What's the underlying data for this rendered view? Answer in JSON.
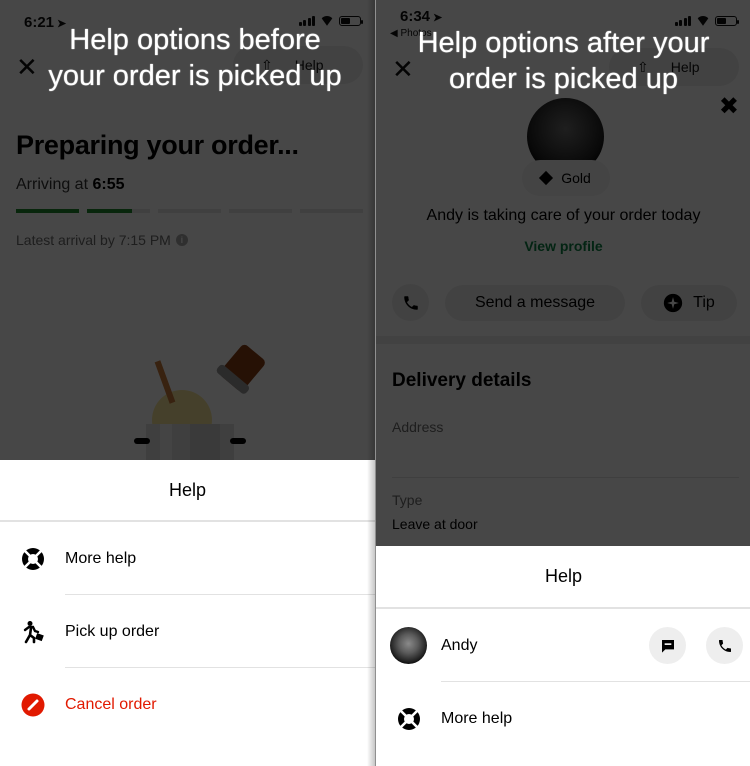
{
  "left": {
    "caption": [
      "Help options before",
      "your order is picked up"
    ],
    "status_bar": {
      "time": "6:21"
    },
    "header": {
      "help_label": "Help"
    },
    "order": {
      "title": "Preparing your order...",
      "arriving_prefix": "Arriving at",
      "arriving_time": "6:55",
      "progress_segments": [
        1.0,
        0.72,
        0,
        0,
        0
      ],
      "latest_arrival": "Latest arrival by 7:15 PM"
    },
    "sheet": {
      "title": "Help",
      "items": [
        {
          "icon": "lifebuoy-icon",
          "label": "More help"
        },
        {
          "icon": "walking-person-icon",
          "label": "Pick up order"
        },
        {
          "icon": "cancel-icon",
          "label": "Cancel order"
        }
      ]
    }
  },
  "right": {
    "caption": [
      "Help options after your",
      "order is picked up"
    ],
    "status_bar": {
      "time": "6:34",
      "back_label": "Photos"
    },
    "header": {
      "help_label": "Help"
    },
    "courier": {
      "badge": "Gold",
      "message": "Andy is taking care of your order today",
      "view_profile": "View profile",
      "send_message": "Send a message",
      "tip": "Tip"
    },
    "delivery": {
      "title": "Delivery details",
      "address_label": "Address",
      "address_value": "",
      "type_label": "Type",
      "type_value": "Leave at door"
    },
    "sheet": {
      "title": "Help",
      "courier_name": "Andy",
      "items": [
        {
          "icon": "lifebuoy-icon",
          "label": "More help"
        }
      ]
    }
  },
  "colors": {
    "progress_green": "#1f8a2b",
    "link_green": "#0e8345",
    "danger_red": "#e11900",
    "overlay": "rgba(0,0,0,0.72)"
  }
}
